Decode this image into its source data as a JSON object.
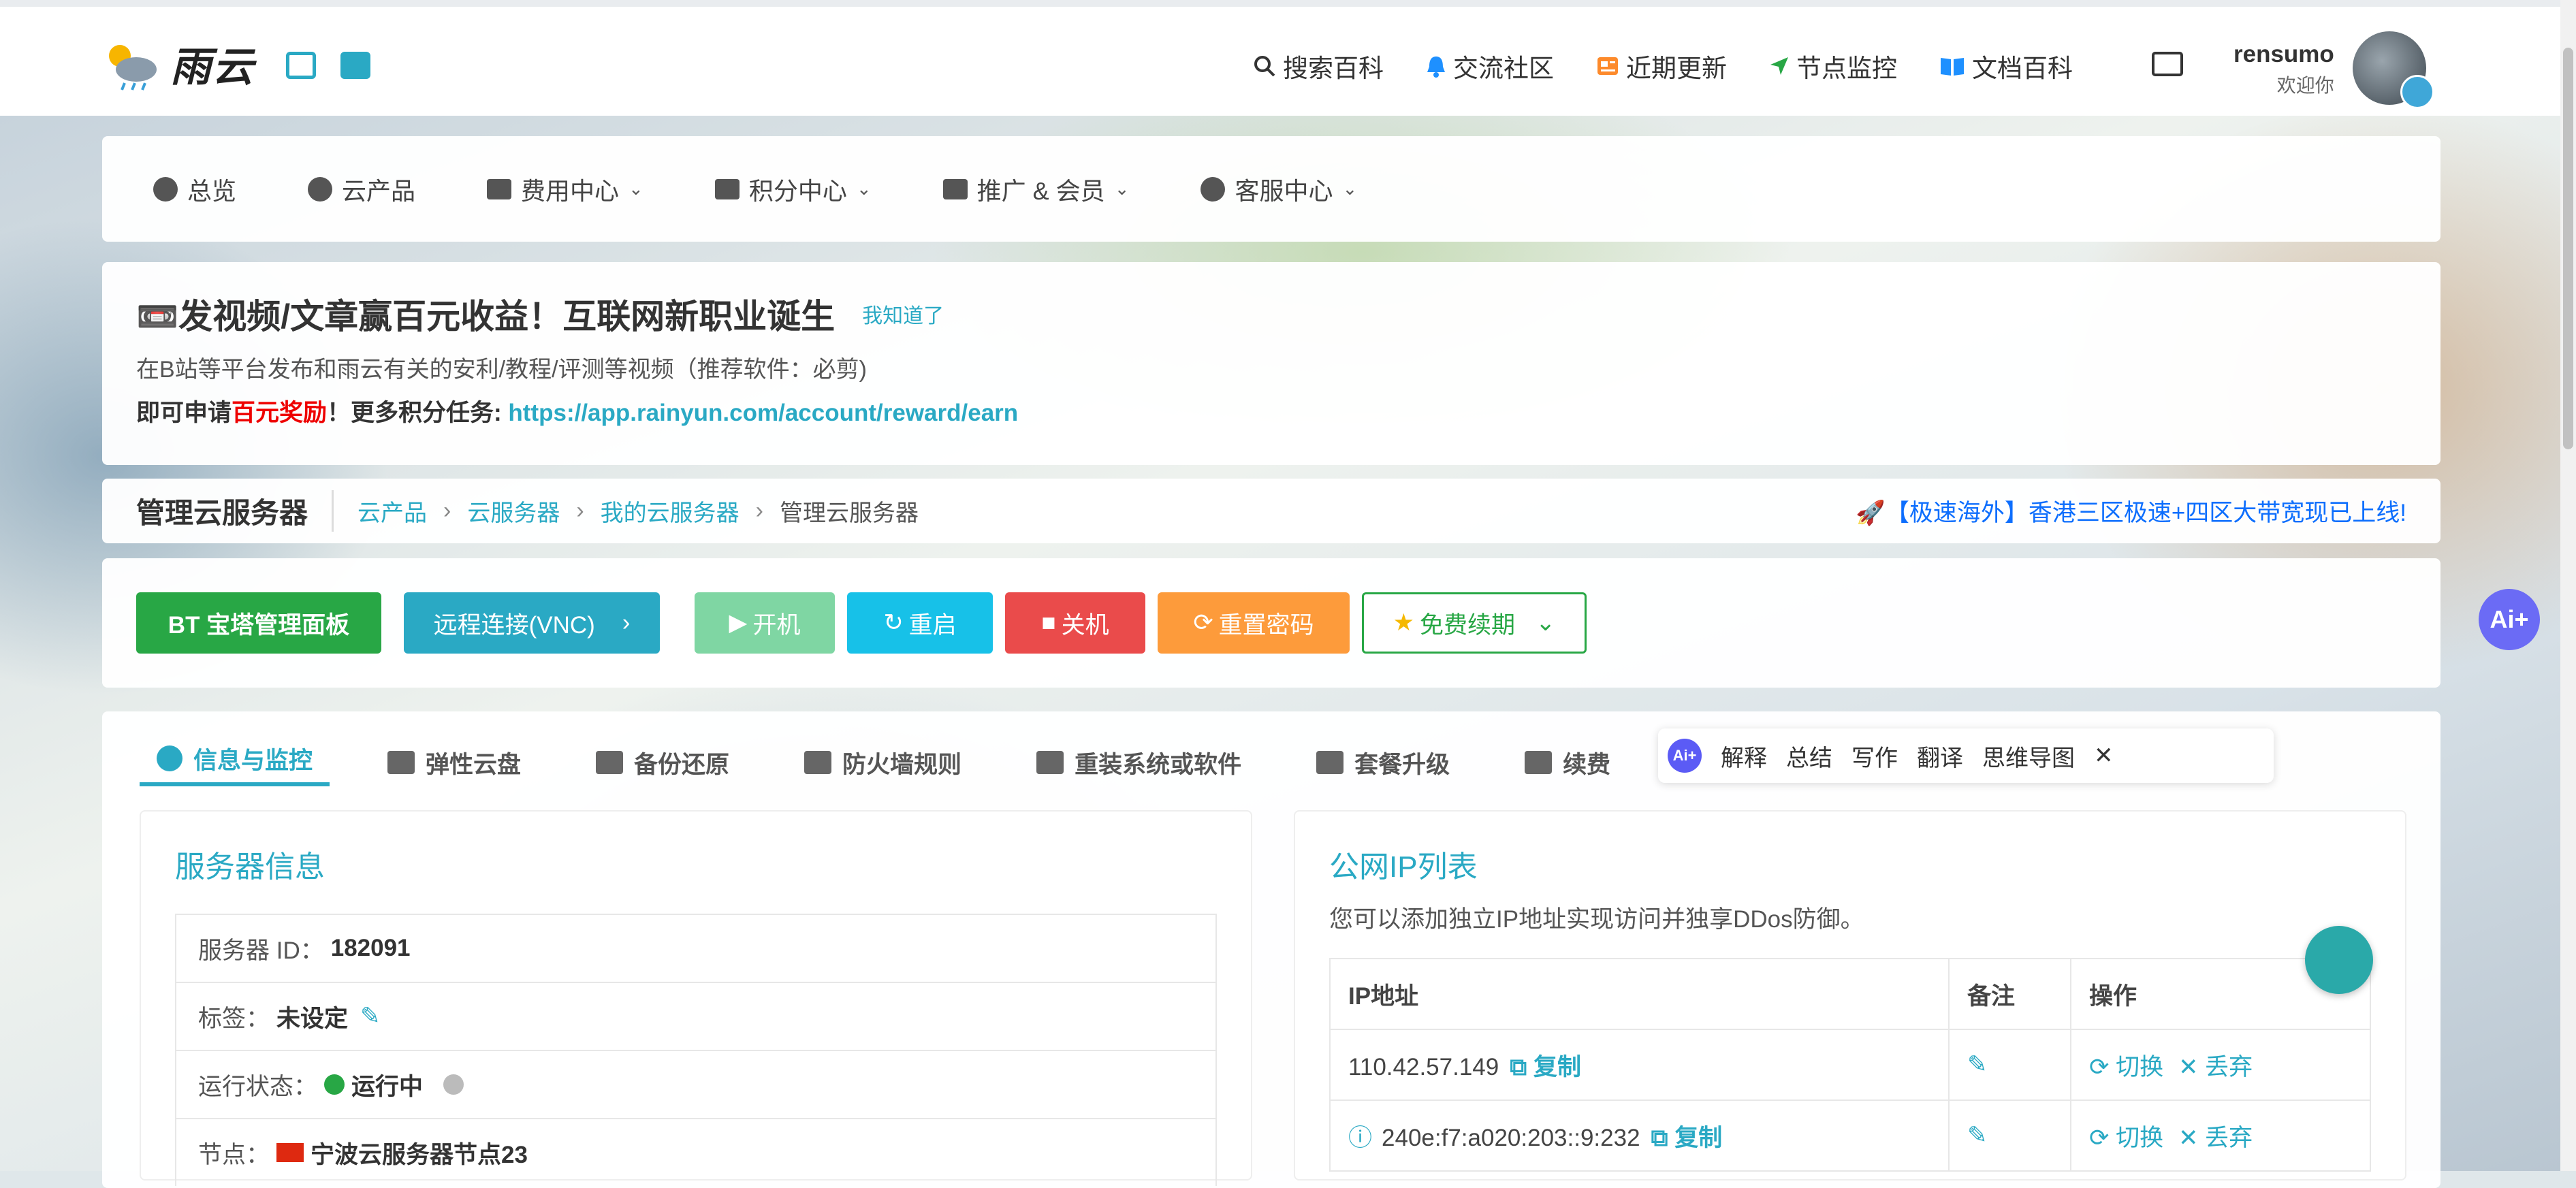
{
  "header": {
    "logo_text": "雨云",
    "nav": [
      {
        "label": "搜索百科",
        "icon": "search-icon"
      },
      {
        "label": "交流社区",
        "icon": "bell-icon"
      },
      {
        "label": "近期更新",
        "icon": "news-icon"
      },
      {
        "label": "节点监控",
        "icon": "location-arrow-icon"
      },
      {
        "label": "文档百科",
        "icon": "book-icon"
      }
    ],
    "user_name": "rensumo",
    "user_greeting": "欢迎你"
  },
  "main_nav": [
    {
      "label": "总览",
      "dropdown": false
    },
    {
      "label": "云产品",
      "dropdown": false
    },
    {
      "label": "费用中心",
      "dropdown": true
    },
    {
      "label": "积分中心",
      "dropdown": true
    },
    {
      "label": "推广 & 会员",
      "dropdown": true
    },
    {
      "label": "客服中心",
      "dropdown": true
    }
  ],
  "notice": {
    "title": "📼发视频/文章赢百元收益！互联网新职业诞生",
    "ack": "我知道了",
    "line2": "在B站等平台发布和雨云有关的安利/教程/评测等视频（推荐软件：必剪)",
    "line3_a": "即可申请",
    "line3_red": "百元奖励",
    "line3_b": "！更多积分任务: ",
    "url": "https://app.rainyun.com/account/reward/earn"
  },
  "breadcrumb": {
    "page_title": "管理云服务器",
    "items": [
      "云产品",
      "云服务器",
      "我的云服务器"
    ],
    "current": "管理云服务器",
    "promo": "🚀【极速海外】香港三区极速+四区大带宽现已上线!"
  },
  "actions": {
    "bt": "BT 宝塔管理面板",
    "vnc": "远程连接(VNC)",
    "start": "开机",
    "restart": "重启",
    "shutdown": "关机",
    "reset_pwd": "重置密码",
    "renew": "免费续期"
  },
  "tabs": [
    "信息与监控",
    "弹性云盘",
    "备份还原",
    "防火墙规则",
    "重装系统或软件",
    "套餐升级",
    "续费"
  ],
  "ai_toolbar": [
    "解释",
    "总结",
    "写作",
    "翻译",
    "思维导图"
  ],
  "server_info": {
    "title": "服务器信息",
    "id_label": "服务器 ID：",
    "id_value": "182091",
    "tag_label": "标签：",
    "tag_value": "未设定",
    "status_label": "运行状态：",
    "status_value": "运行中",
    "node_label": "节点：",
    "node_value": "宁波云服务器节点23"
  },
  "ip_list": {
    "title": "公网IP列表",
    "subtitle": "您可以添加独立IP地址实现访问并独享DDos防御。",
    "headers": [
      "IP地址",
      "备注",
      "操作"
    ],
    "copy": "复制",
    "switch": "切换",
    "discard": "丢弃",
    "rows": [
      "110.42.57.149",
      "240e:f7:a020:203::9:232"
    ]
  },
  "colors": {
    "accent": "#2aa9c4",
    "green": "#28a745",
    "cyan": "#17c1e8",
    "red": "#ea4b4b",
    "orange": "#fd9b3b"
  }
}
